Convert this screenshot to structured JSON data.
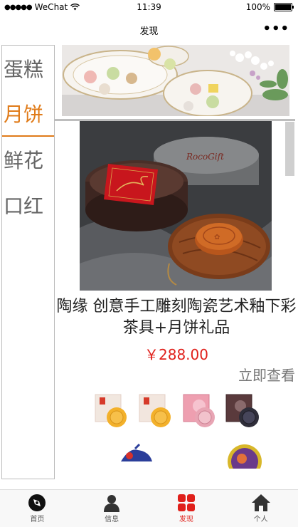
{
  "status_bar": {
    "carrier": "WeChat",
    "time": "11:39",
    "battery": "100%",
    "battery_level": 1.0
  },
  "navbar": {
    "title": "发现",
    "more_icon": "more-dots-icon"
  },
  "categories": [
    {
      "label": "蛋糕",
      "active": false
    },
    {
      "label": "月饼",
      "active": true
    },
    {
      "label": "鲜花",
      "active": false
    },
    {
      "label": "口红",
      "active": false
    }
  ],
  "product": {
    "title": "陶缘 创意手工雕刻陶瓷艺术釉下彩茶具+月饼礼品",
    "price": "￥288.00",
    "view_label": "立即查看",
    "box_text": "RocoGift"
  },
  "tabbar": {
    "items": [
      {
        "label": "首页",
        "icon": "compass-icon"
      },
      {
        "label": "信息",
        "icon": "user-icon"
      },
      {
        "label": "发现",
        "icon": "grid-icon"
      },
      {
        "label": "个人",
        "icon": "home-icon"
      }
    ],
    "active_index": 2
  },
  "colors": {
    "accent": "#e07b19",
    "price": "#e0201b",
    "tab_active": "#e0201b"
  }
}
